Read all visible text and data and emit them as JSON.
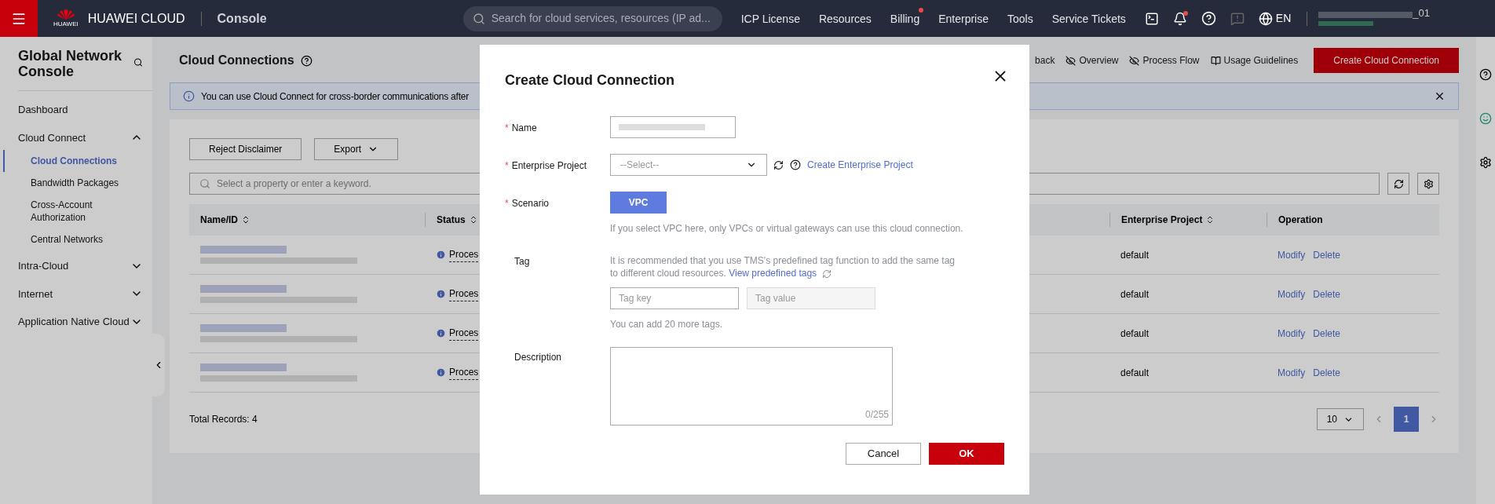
{
  "topbar": {
    "brand": "HUAWEI CLOUD",
    "logo_caption": "HUAWEI",
    "section": "Console",
    "search_placeholder": "Search for cloud services, resources (IP ad...",
    "nav": [
      {
        "label": "ICP License",
        "badge": false
      },
      {
        "label": "Resources",
        "badge": false
      },
      {
        "label": "Billing",
        "badge": true
      },
      {
        "label": "Enterprise",
        "badge": false
      },
      {
        "label": "Tools",
        "badge": false
      },
      {
        "label": "Service Tickets",
        "badge": false
      }
    ],
    "notifications_badge": true,
    "language": "EN",
    "account_suffix": "_01"
  },
  "sidebar": {
    "title": "Global Network Console",
    "items": [
      {
        "label": "Dashboard",
        "selected": false
      },
      {
        "label": "Cloud Connect",
        "selected": false,
        "expanded": true,
        "children": [
          {
            "label": "Cloud Connections",
            "selected": true
          },
          {
            "label": "Bandwidth Packages",
            "selected": false
          },
          {
            "label": "Cross-Account Authorization",
            "selected": false
          },
          {
            "label": "Central Networks",
            "selected": false
          }
        ]
      },
      {
        "label": "Intra-Cloud",
        "selected": false,
        "expanded": false
      },
      {
        "label": "Internet",
        "selected": false,
        "expanded": false
      },
      {
        "label": "Application Native Cloud",
        "selected": false,
        "expanded": false
      }
    ]
  },
  "page": {
    "title": "Cloud Connections",
    "header_links": [
      "back",
      "Overview",
      "Process Flow",
      "Usage Guidelines"
    ],
    "create_button": "Create Cloud Connection",
    "alert": "You can use Cloud Connect for cross-border communications after",
    "toolbar": {
      "buttons": [
        "Reject Disclaimer",
        "Export"
      ],
      "search_placeholder": "Select a property or enter a keyword."
    },
    "table": {
      "columns": [
        "Name/ID",
        "Status",
        "Enterprise Project",
        "Operation"
      ],
      "rows": [
        {
          "status": "Proces",
          "enterprise_project": "default",
          "actions": [
            "Modify",
            "Delete"
          ]
        },
        {
          "status": "Proces",
          "enterprise_project": "default",
          "actions": [
            "Modify",
            "Delete"
          ]
        },
        {
          "status": "Proces",
          "enterprise_project": "default",
          "actions": [
            "Modify",
            "Delete"
          ]
        },
        {
          "status": "Proces",
          "enterprise_project": "default",
          "actions": [
            "Modify",
            "Delete"
          ]
        }
      ]
    },
    "total": "Total Records: 4",
    "page_size": "10",
    "pages": [
      {
        "label": "1",
        "selected": true
      }
    ]
  },
  "dialog": {
    "title": "Create Cloud Connection",
    "required_mark": "*",
    "name": {
      "label": "Name",
      "required": true
    },
    "enterprise_project": {
      "label": "Enterprise Project",
      "required": true,
      "placeholder": "--Select--",
      "link": "Create Enterprise Project"
    },
    "scenario": {
      "label": "Scenario",
      "required": true,
      "options": [
        {
          "label": "VPC",
          "selected": true
        }
      ],
      "hint": "If you select VPC here, only VPCs or virtual gateways can use this cloud connection."
    },
    "tag": {
      "label": "Tag",
      "required": false,
      "hint": "It is recommended that you use TMS's predefined tag function to add the same tag to different cloud resources.",
      "link": "View predefined tags",
      "key_placeholder": "Tag key",
      "value_placeholder": "Tag value",
      "value_disabled": true,
      "note": "You can add 20 more tags."
    },
    "description": {
      "label": "Description",
      "required": false,
      "counter": "0/255"
    },
    "buttons": {
      "cancel": "Cancel",
      "ok": "OK"
    }
  }
}
